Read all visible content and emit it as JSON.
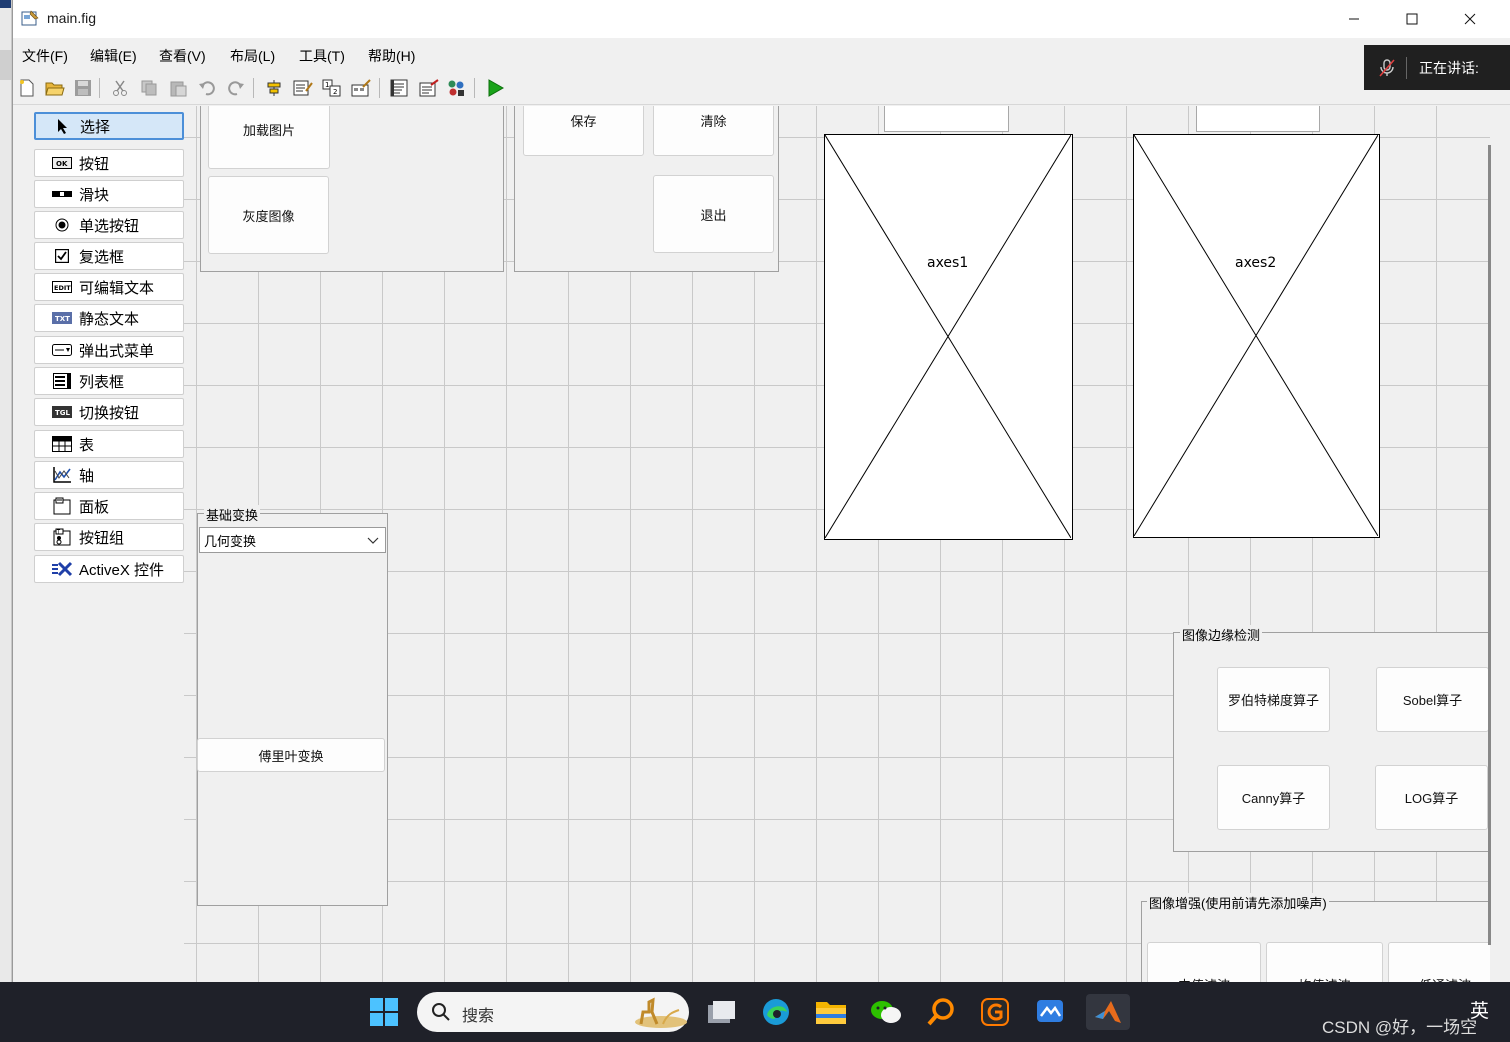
{
  "window": {
    "title": "main.fig"
  },
  "menu": [
    "文件(F)",
    "编辑(E)",
    "查看(V)",
    "布局(L)",
    "工具(T)",
    "帮助(H)"
  ],
  "speaking": {
    "label": "正在讲话:"
  },
  "palette": [
    {
      "label": "选择",
      "icon": "cursor-icon"
    },
    {
      "label": "按钮",
      "icon": "push-button-icon"
    },
    {
      "label": "滑块",
      "icon": "slider-icon"
    },
    {
      "label": "单选按钮",
      "icon": "radio-button-icon"
    },
    {
      "label": "复选框",
      "icon": "checkbox-icon"
    },
    {
      "label": "可编辑文本",
      "icon": "edit-text-icon"
    },
    {
      "label": "静态文本",
      "icon": "static-text-icon"
    },
    {
      "label": "弹出式菜单",
      "icon": "popup-menu-icon"
    },
    {
      "label": "列表框",
      "icon": "listbox-icon"
    },
    {
      "label": "切换按钮",
      "icon": "toggle-button-icon"
    },
    {
      "label": "表",
      "icon": "table-icon"
    },
    {
      "label": "轴",
      "icon": "axes-icon"
    },
    {
      "label": "面板",
      "icon": "panel-icon"
    },
    {
      "label": "按钮组",
      "icon": "button-group-icon"
    },
    {
      "label": "ActiveX 控件",
      "icon": "activex-icon"
    }
  ],
  "canvas": {
    "file_buttons": {
      "load": "加载图片",
      "gray": "灰度图像"
    },
    "action_buttons": {
      "save": "保存",
      "clear": "清除",
      "exit": "退出"
    },
    "axes": [
      "axes1",
      "axes2"
    ],
    "basic_panel": {
      "title": "基础变换",
      "popup_value": "几何变换",
      "fourier": "傅里叶变换"
    },
    "edge_panel": {
      "title": "图像边缘检测",
      "roberts": "罗伯特梯度算子",
      "sobel": "Sobel算子",
      "canny": "Canny算子",
      "log": "LOG算子"
    },
    "enhance_panel": {
      "title": "图像增强(使用前请先添加噪声)",
      "median": "中值滤波",
      "mean": "均值滤波",
      "lowpass": "低通滤波"
    }
  },
  "taskbar": {
    "search_placeholder": "搜索",
    "watermark": "CSDN @好，一场空",
    "ime": "英"
  },
  "colors": {
    "selected_bg": "#d5e7f8",
    "selected_border": "#4c8fd8",
    "taskbar_bg": "#1f2129",
    "run_green": "#1aa31a"
  }
}
